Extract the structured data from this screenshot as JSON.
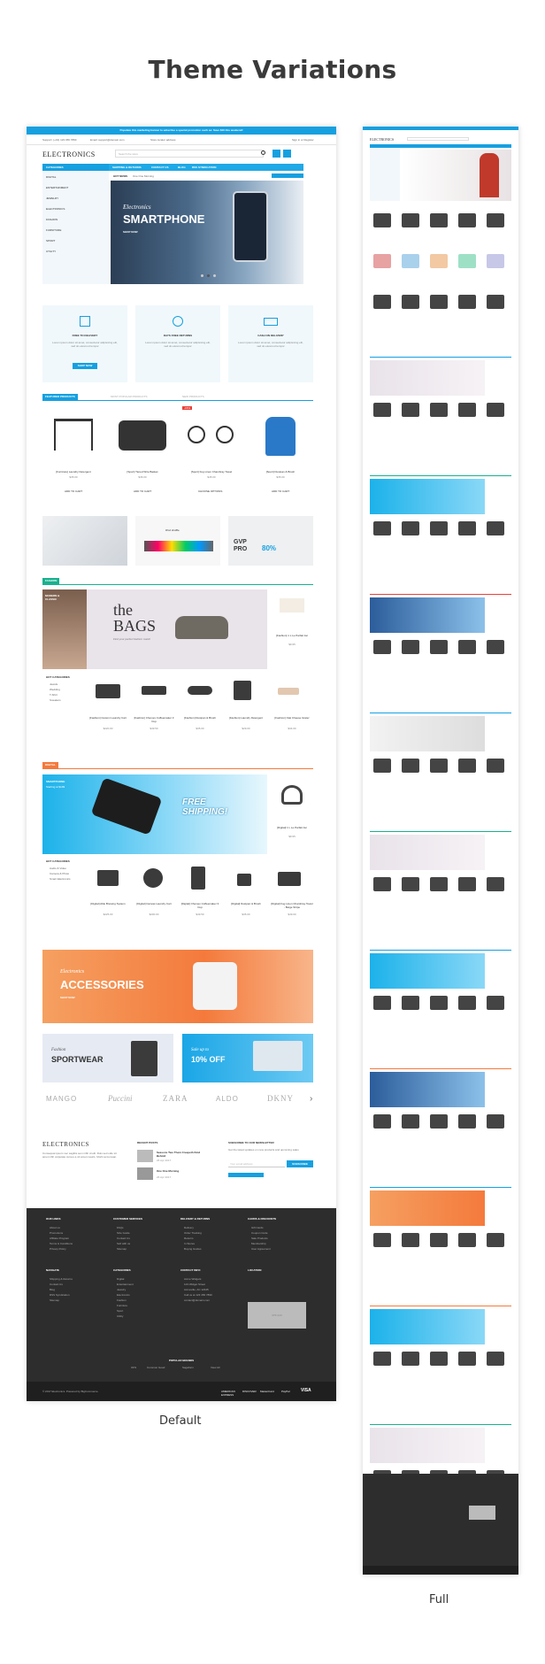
{
  "page": {
    "title": "Theme Variations",
    "caption_default": "Default",
    "caption_full": "Full"
  },
  "colors": {
    "accent": "#16a0e0",
    "orange": "#f47a3c",
    "green": "#19b18f",
    "red": "#e8413a",
    "footer": "#2d2d2d"
  },
  "topbar": {
    "promo": "Populate this marketing banner to advertise a special promotion such as: Save $10 this weekend!",
    "support": "Support: (+01) 123 456 7890",
    "email": "Email: support@domain.com",
    "store_locator": "Store locator address",
    "sign_in": "Sign in or Register"
  },
  "header": {
    "logo": "ELECTRONICS",
    "search_placeholder": "Search the store"
  },
  "nav": {
    "categories_label": "CATEGORIES",
    "links": [
      "SHIPPING & RETURNS",
      "CONTACT US",
      "BLOG",
      "RSS SYNDICATION"
    ],
    "hot_news_label": "HOT NEWS",
    "hot_news_text": "One One Morning"
  },
  "categories": [
    "DIGITAL",
    "ENTERTAINMENT",
    "JEWELRY",
    "ELECTRONICS",
    "FASHION",
    "FURNITURE",
    "SPORT",
    "UTILITY"
  ],
  "slider": {
    "brand": "Electronics",
    "title": "SMARTPHONE",
    "cta": "SHOP NOW"
  },
  "features": [
    {
      "icon": "box-icon",
      "title": "FREE TO DELIVERY",
      "text": "Lorem ipsum dolor sit amet, consectetur adipisicing elit, sed do eiusmod tempor",
      "cta": "SHOP NOW"
    },
    {
      "icon": "24-hours-icon",
      "title": "DAYS FREE RETURNS",
      "text": "Lorem ipsum dolor sit amet, consectetur adipisicing elit, sed do eiusmod tempor"
    },
    {
      "icon": "truck-icon",
      "title": "CASH ON DELIVERY",
      "text": "Lorem ipsum dolor sit amet, consectetur adipisicing elit, sed do eiusmod tempor"
    }
  ],
  "product_tabs": [
    "FEATURED PRODUCTS",
    "MOST POPULAR PRODUCTS",
    "NEW PRODUCTS"
  ],
  "featured_products": [
    {
      "name": "[Furniture] Laundry Detergent",
      "price": "$35.00",
      "cta": "ADD TO CART"
    },
    {
      "name": "[Sport] Tiered Wire Basket",
      "price": "$36.00",
      "cta": "ADD TO CART"
    },
    {
      "name": "[Sport] Fog Linen Chambray Towel",
      "price": "$45.00",
      "cta": "CHOOSE OPTIONS",
      "badge": "-15%"
    },
    {
      "name": "[Sport] Dustpan & Brush",
      "price": "$35.00",
      "cta": "ADD TO CART"
    }
  ],
  "promo_banners": {
    "ipod": "iPod shuffle",
    "gvp": "GVP PRO",
    "discount": "80%"
  },
  "fashion": {
    "tab": "FASHION",
    "small": "MODERN & CLASSIC",
    "title": "the BAGS",
    "subtitle": "Find your perfect fashion match",
    "hot_label": "HOT CATEGORIES",
    "hot_items": [
      "Jewels",
      "Wedding",
      "T-Shirt",
      "Sneakers"
    ],
    "side_product": {
      "name": "[Fashion] 1 L Le Parfait Jar",
      "price": "$9.95"
    },
    "products": [
      {
        "name": "[Fashion] Custom Laundry Cart",
        "price": "$220.00"
      },
      {
        "name": "[Fashion] Chemex Coffeemaker 3 Cup",
        "price": "$49.50"
      },
      {
        "name": "[Fashion] Dustpan & Brush",
        "price": "$35.00"
      },
      {
        "name": "[Fashion] Laundry Detergent",
        "price": "$29.00"
      },
      {
        "name": "[Fashion] Oak Cheese Grater",
        "price": "$34.00"
      }
    ]
  },
  "digital": {
    "tab": "DIGITAL",
    "small": "SMARTPHONE",
    "small_sub": "Starting at $199",
    "free_shipping": "FREE SHIPPING!",
    "hot_label": "HOT CATEGORIES",
    "hot_items": [
      "Audio & Video",
      "Camera & Photo",
      "Smart Electronics"
    ],
    "side_product": {
      "name": "[Digital] 1 L Le Parfait Jar",
      "price": "$9.95"
    },
    "products": [
      {
        "name": "[Digital] Able Brewing System",
        "price": "$225.00"
      },
      {
        "name": "[Digital] Canvas Laundry Cart",
        "price": "$200.00"
      },
      {
        "name": "[Digital] Chemex Coffeemaker 3 Cup",
        "price": "$49.50"
      },
      {
        "name": "[Digital] Dustpan & Brush",
        "price": "$35.00"
      },
      {
        "name": "[Digital] Fog Linen Chambray Towel - Beige Stripe",
        "price": "$49.00"
      }
    ]
  },
  "accessories": {
    "brand": "Electronics",
    "title": "ACCESSORIES",
    "cta": "SHOP NOW"
  },
  "bottom_banners": {
    "left_small": "Fashion",
    "left_title": "SPORTWEAR",
    "right_small": "Sale up to",
    "right_title": "10% OFF"
  },
  "brands": [
    "MANGO",
    "Puccini",
    "ZARA",
    "ALDO",
    "DKNY"
  ],
  "footer_top": {
    "logo": "ELECTRONICS",
    "about": "Consequat ipsum nec sagittis sem nibh id elit. Duis sed odio sit amet nibh vulputate cursus a sit amet mauris. Morbi accumsan.",
    "posts_title": "RECENT POSTS",
    "posts": [
      {
        "title": "Seasons Two Them Creepeth Kind Behold",
        "date": "26 Apr 2017"
      },
      {
        "title": "One One Morning",
        "date": "26 Apr 2017"
      }
    ],
    "newsletter_title": "SUBSCRIBE TO OUR NEWSLETTER",
    "newsletter_text": "Get the latest updates on new products and upcoming sales",
    "newsletter_placeholder": "Your email address",
    "newsletter_button": "SUBSCRIBE"
  },
  "footer": {
    "cols": [
      {
        "title": "OUR LINKS",
        "items": [
          "About us",
          "Promotions",
          "Affiliate Program",
          "Terms & Conditions",
          "Privacy Policy"
        ]
      },
      {
        "title": "CUSTOMER SERVICES",
        "items": [
          "FAQs",
          "Size Guide",
          "Contact Us",
          "Sell with us",
          "Sitemap"
        ]
      },
      {
        "title": "DELIVERY & RETURNS",
        "items": [
          "Delivery",
          "Order Tracking",
          "Returns",
          "In Stores",
          "Buying Guides"
        ]
      },
      {
        "title": "CARDS & DISCOUNTS",
        "items": [
          "Gift Cards",
          "Coupon Code",
          "Sale Products",
          "Membership",
          "User Agreement"
        ]
      },
      {
        "title": "NAVIGATE",
        "items": [
          "Shipping & Returns",
          "Contact Us",
          "Blog",
          "RSS Syndication",
          "Sitemap"
        ]
      },
      {
        "title": "CATEGORIES",
        "items": [
          "Digital",
          "Entertainment",
          "Jewelry",
          "Electronics",
          "Fashion",
          "Furniture",
          "Sport",
          "Utility"
        ]
      },
      {
        "title": "CONTACT INFO",
        "items": [
          "Acme Widgets",
          "123 Widget Street",
          "Acmeville, AC 12345",
          "Call us at 123 456 7890",
          "contact@domain.com"
        ]
      },
      {
        "title": "LOCATION",
        "items": []
      }
    ],
    "map_label": "375×120",
    "popular_brands_title": "POPULAR BRANDS",
    "popular_brands": [
      "OFS",
      "Common Good",
      "Sagaform",
      "View All"
    ],
    "copyright": "© 2017 Electronics. Powered by BigCommerce.",
    "payments": [
      "AMERICAN EXPRESS",
      "DISCOVER",
      "MasterCard",
      "PayPal",
      "VISA"
    ]
  }
}
